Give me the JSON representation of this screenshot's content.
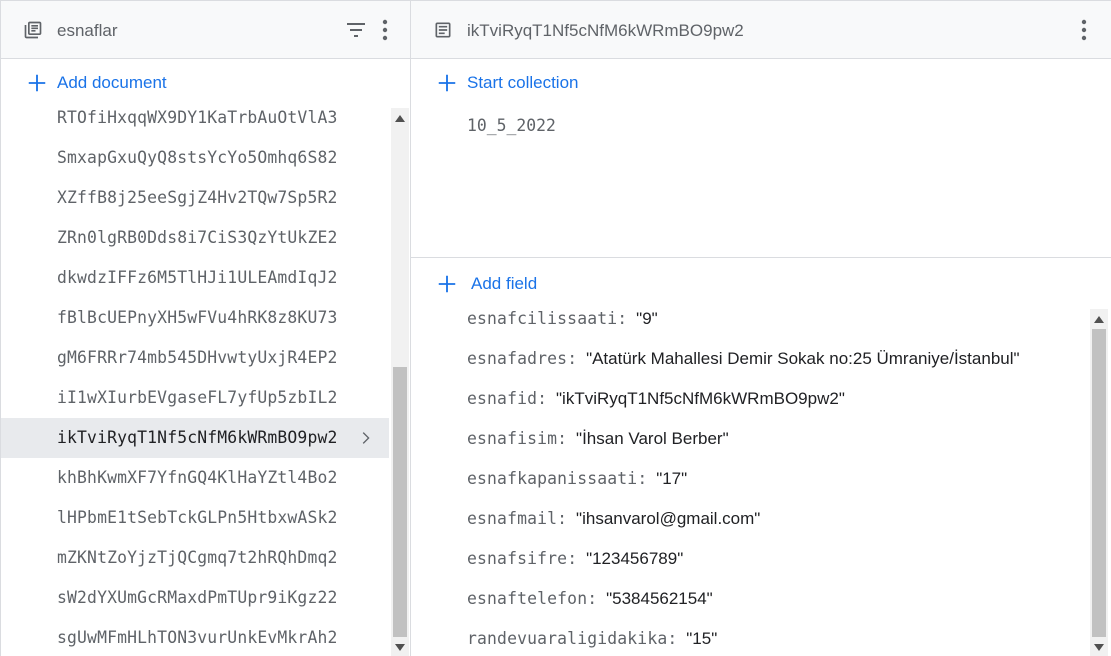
{
  "left_panel": {
    "title": "esnaflar",
    "add_document_label": "Add document",
    "documents": [
      "RTOfiHxqqWX9DY1KaTrbAuOtVlA3",
      "SmxapGxuQyQ8stsYcYo5Omhq6S82",
      "XZffB8j25eeSgjZ4Hv2TQw7Sp5R2",
      "ZRn0lgRB0Dds8i7CiS3QzYtUkZE2",
      "dkwdzIFFz6M5TlHJi1ULEAmdIqJ2",
      "fBlBcUEPnyXH5wFVu4hRK8z8KU73",
      "gM6FRRr74mb545DHvwtyUxjR4EP2",
      "iI1wXIurbEVgaseFL7yfUp5zbIL2",
      "ikTviRyqT1Nf5cNfM6kWRmBO9pw2",
      "khBhKwmXF7YfnGQ4KlHaYZtl4Bo2",
      "lHPbmE1tSebTckGLPn5HtbxwASk2",
      "mZKNtZoYjzTjQCgmq7t2hRQhDmq2",
      "sW2dYXUmGcRMaxdPmTUpr9iKgz22",
      "sgUwMFmHLhTON3vurUnkEvMkrAh2"
    ],
    "selected_index": 8
  },
  "right_panel": {
    "title": "ikTviRyqT1Nf5cNfM6kWRmBO9pw2",
    "start_collection_label": "Start collection",
    "collections": [
      "10_5_2022"
    ],
    "add_field_label": "Add field",
    "fields": [
      {
        "key": "esnafcilissaati",
        "value": "\"9\""
      },
      {
        "key": "esnafadres",
        "value": "\"Atatürk Mahallesi Demir Sokak no:25 Ümraniye/İstanbul\""
      },
      {
        "key": "esnafid",
        "value": "\"ikTviRyqT1Nf5cNfM6kWRmBO9pw2\""
      },
      {
        "key": "esnafisim",
        "value": "\"İhsan Varol Berber\""
      },
      {
        "key": "esnafkapanissaati",
        "value": "\"17\""
      },
      {
        "key": "esnafmail",
        "value": "\"ihsanvarol@gmail.com\""
      },
      {
        "key": "esnafsifre",
        "value": "\"123456789\""
      },
      {
        "key": "esnaftelefon",
        "value": "\"5384562154\""
      },
      {
        "key": "randevuaraligidakika",
        "value": "\"15\""
      }
    ]
  },
  "colors": {
    "accent": "#1a73e8",
    "muted_text": "#5f6368",
    "header_bg": "#f8f9fa",
    "selected_bg": "#e8eaed",
    "border": "#dadce0"
  },
  "icons": {
    "collection": "collection-stack-icon",
    "document": "document-icon",
    "filter": "filter-icon",
    "more": "more-vert-icon",
    "add": "plus-icon",
    "selected_chevron": "chevron-right-icon"
  }
}
